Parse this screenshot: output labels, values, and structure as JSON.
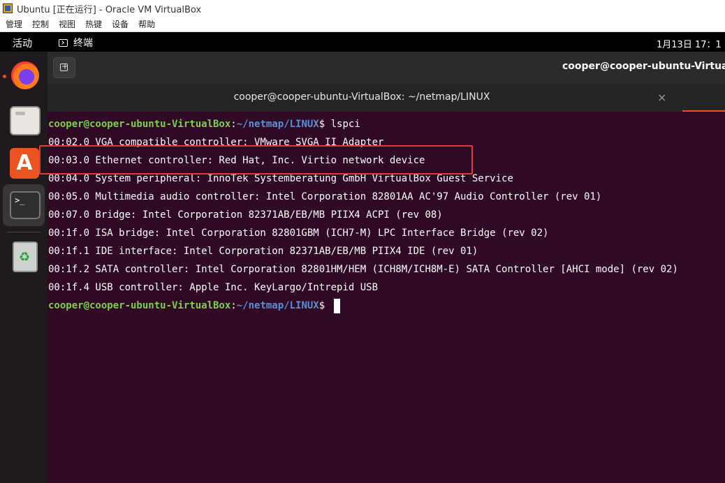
{
  "vbox": {
    "title": "Ubuntu [正在运行] - Oracle VM VirtualBox",
    "menu": [
      "管理",
      "控制",
      "视图",
      "热键",
      "设备",
      "帮助"
    ]
  },
  "topbar": {
    "activities": "活动",
    "app_name": "终端",
    "clock": "1月13日  17：1"
  },
  "dock": {
    "items": [
      {
        "name": "firefox-icon",
        "running": true
      },
      {
        "name": "files-icon",
        "running": false
      },
      {
        "name": "software-center-icon",
        "running": false
      },
      {
        "name": "terminal-icon",
        "running": true,
        "active": true
      },
      {
        "name": "trash-icon",
        "running": false
      }
    ]
  },
  "terminal": {
    "header_title": "cooper@cooper-ubuntu-VirtualBox",
    "tab_title": "cooper@cooper-ubuntu-VirtualBox: ~/netmap/LINUX",
    "prompt": {
      "user_host": "cooper@cooper-ubuntu-VirtualBox",
      "separator": ":",
      "path": "~/netmap/LINUX",
      "symbol": "$ "
    },
    "command": "lspci",
    "output": [
      "00:02.0 VGA compatible controller: VMware SVGA II Adapter",
      "00:03.0 Ethernet controller: Red Hat, Inc. Virtio network device",
      "00:04.0 System peripheral: InnoTek Systemberatung GmbH VirtualBox Guest Service",
      "00:05.0 Multimedia audio controller: Intel Corporation 82801AA AC'97 Audio Controller (rev 01)",
      "00:07.0 Bridge: Intel Corporation 82371AB/EB/MB PIIX4 ACPI (rev 08)",
      "00:1f.0 ISA bridge: Intel Corporation 82801GBM (ICH7-M) LPC Interface Bridge (rev 02)",
      "00:1f.1 IDE interface: Intel Corporation 82371AB/EB/MB PIIX4 IDE (rev 01)",
      "00:1f.2 SATA controller: Intel Corporation 82801HM/HEM (ICH8M/ICH8M-E) SATA Controller [AHCI mode] (rev 02)",
      "00:1f.4 USB controller: Apple Inc. KeyLargo/Intrepid USB"
    ],
    "highlighted_line_index": 1,
    "colors": {
      "background": "#300a24",
      "user": "#7cd04a",
      "path": "#5b8fd6",
      "highlight_box": "#e03b3b"
    }
  }
}
